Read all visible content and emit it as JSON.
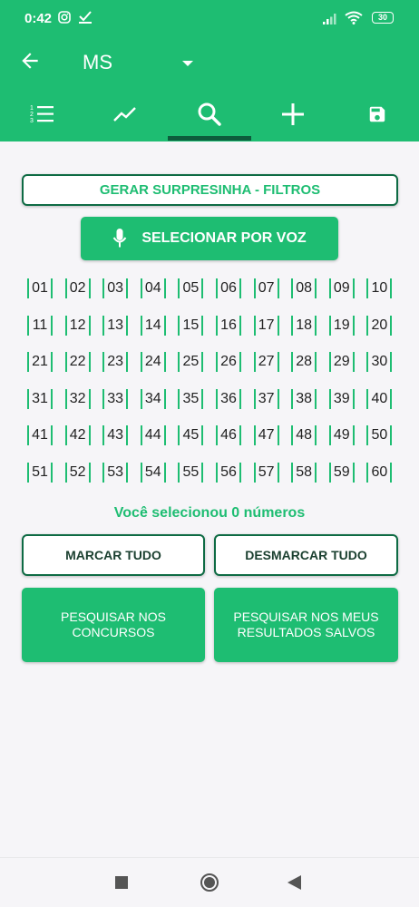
{
  "status_bar": {
    "time": "0:42",
    "battery": "30",
    "icons": [
      "instagram-icon",
      "check-icon",
      "signal-icon",
      "wifi-icon",
      "battery-icon"
    ]
  },
  "toolbar": {
    "title": "MS",
    "back_icon": "arrow-left-icon",
    "dropdown_icon": "caret-down-icon"
  },
  "tabs": [
    {
      "name": "list",
      "icon": "numbered-list-icon"
    },
    {
      "name": "stats",
      "icon": "trend-icon"
    },
    {
      "name": "search",
      "icon": "search-icon",
      "active": true
    },
    {
      "name": "add",
      "icon": "plus-icon"
    },
    {
      "name": "save",
      "icon": "save-icon"
    }
  ],
  "filters_button": "GERAR SURPRESINHA - FILTROS",
  "voice_button": "SELECIONAR POR VOZ",
  "numbers": [
    "01",
    "02",
    "03",
    "04",
    "05",
    "06",
    "07",
    "08",
    "09",
    "10",
    "11",
    "12",
    "13",
    "14",
    "15",
    "16",
    "17",
    "18",
    "19",
    "20",
    "21",
    "22",
    "23",
    "24",
    "25",
    "26",
    "27",
    "28",
    "29",
    "30",
    "31",
    "32",
    "33",
    "34",
    "35",
    "36",
    "37",
    "38",
    "39",
    "40",
    "41",
    "42",
    "43",
    "44",
    "45",
    "46",
    "47",
    "48",
    "49",
    "50",
    "51",
    "52",
    "53",
    "54",
    "55",
    "56",
    "57",
    "58",
    "59",
    "60"
  ],
  "selected_message": "Você selecionou 0 números",
  "actions": {
    "mark_all": "MARCAR TUDO",
    "unmark_all": "DESMARCAR TUDO",
    "search_contests": "PESQUISAR NOS CONCURSOS",
    "search_saved": "PESQUISAR NOS MEUS RESULTADOS SALVOS"
  },
  "colors": {
    "primary": "#1ebd72",
    "dark_green": "#0e6b44",
    "background": "#f6f5f8"
  }
}
